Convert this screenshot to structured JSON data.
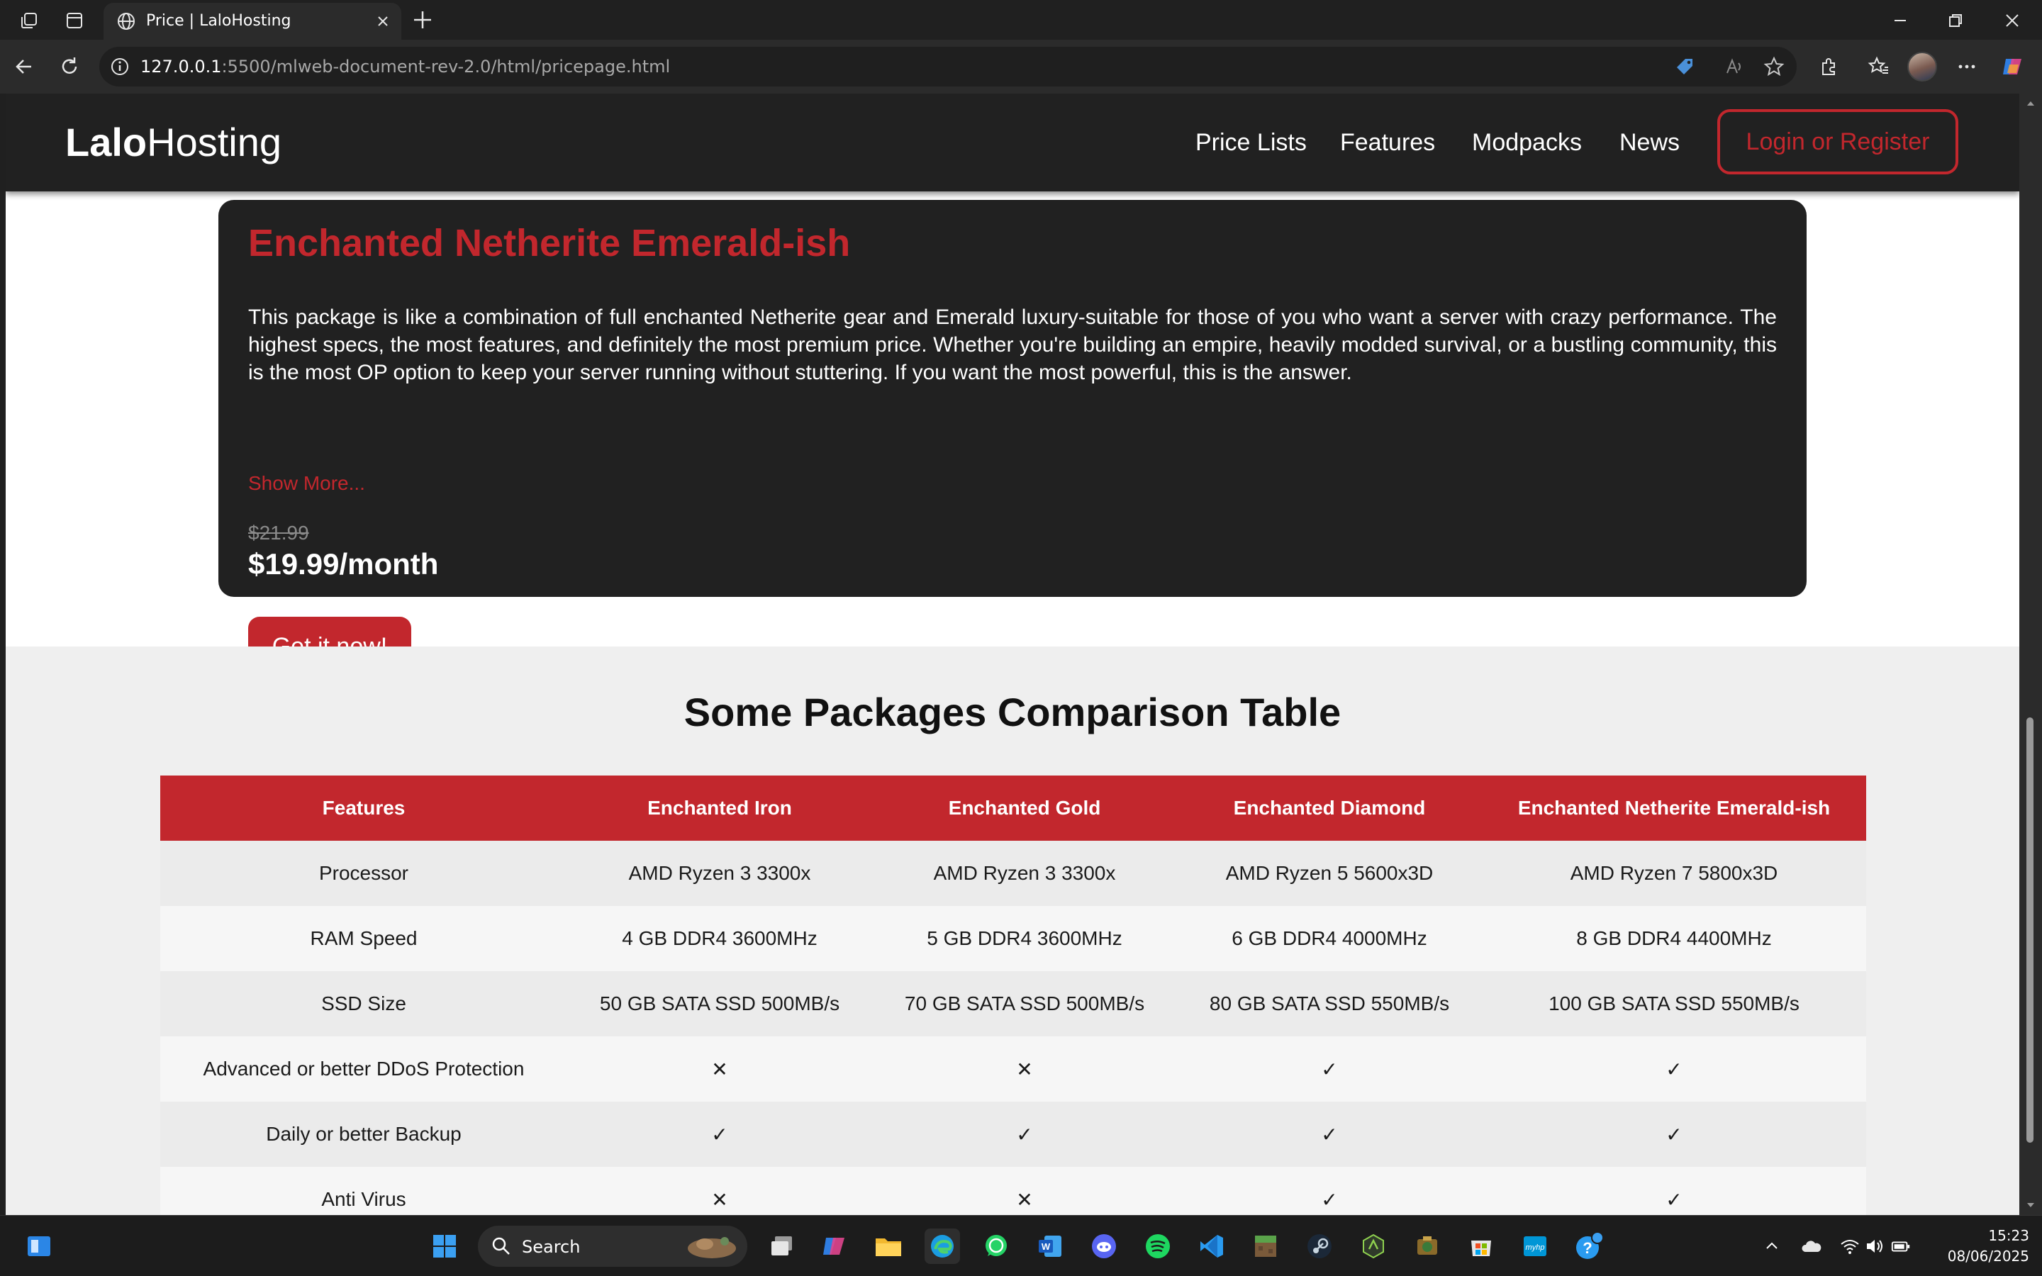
{
  "browser": {
    "tab_title": "Price | LaloHosting",
    "url_host": "127.0.0.1",
    "url_path": ":5500/mlweb-document-rev-2.0/html/pricepage.html"
  },
  "site": {
    "logo_bold": "Lalo",
    "logo_light": "Hosting",
    "nav": [
      "Price Lists",
      "Features",
      "Modpacks",
      "News"
    ],
    "login_label": "Login or Register",
    "accent_color": "#c2272d"
  },
  "package": {
    "title": "Enchanted Netherite Emerald-ish",
    "description": "This package is like a combination of full enchanted Netherite gear and Emerald luxury-suitable for those of you who want a server with crazy performance. The highest specs, the most features, and definitely the most premium price. Whether you're building an empire, heavily modded survival, or a bustling community, this is the most OP option to keep your server running without stuttering. If you want the most powerful, this is the answer.",
    "show_more": "Show More...",
    "old_price": "$21.99",
    "price": "$19.99/month",
    "cta": "Get it now!"
  },
  "comparison": {
    "title": "Some Packages Comparison Table",
    "headers": [
      "Features",
      "Enchanted Iron",
      "Enchanted Gold",
      "Enchanted Diamond",
      "Enchanted Netherite Emerald-ish"
    ],
    "rows": [
      [
        "Processor",
        "AMD Ryzen 3 3300x",
        "AMD Ryzen 3 3300x",
        "AMD Ryzen 5 5600x3D",
        "AMD Ryzen 7 5800x3D"
      ],
      [
        "RAM Speed",
        "4 GB DDR4 3600MHz",
        "5 GB DDR4 3600MHz",
        "6 GB DDR4 4000MHz",
        "8 GB DDR4 4400MHz"
      ],
      [
        "SSD Size",
        "50 GB SATA SSD 500MB/s",
        "70 GB SATA SSD 500MB/s",
        "80 GB SATA SSD 550MB/s",
        "100 GB SATA SSD 550MB/s"
      ],
      [
        "Advanced or better DDoS Protection",
        "✕",
        "✕",
        "✓",
        "✓"
      ],
      [
        "Daily or better Backup",
        "✓",
        "✓",
        "✓",
        "✓"
      ],
      [
        "Anti Virus",
        "✕",
        "✕",
        "✓",
        "✓"
      ]
    ]
  },
  "taskbar": {
    "search_label": "Search",
    "time": "15:23",
    "date": "08/06/2025"
  }
}
